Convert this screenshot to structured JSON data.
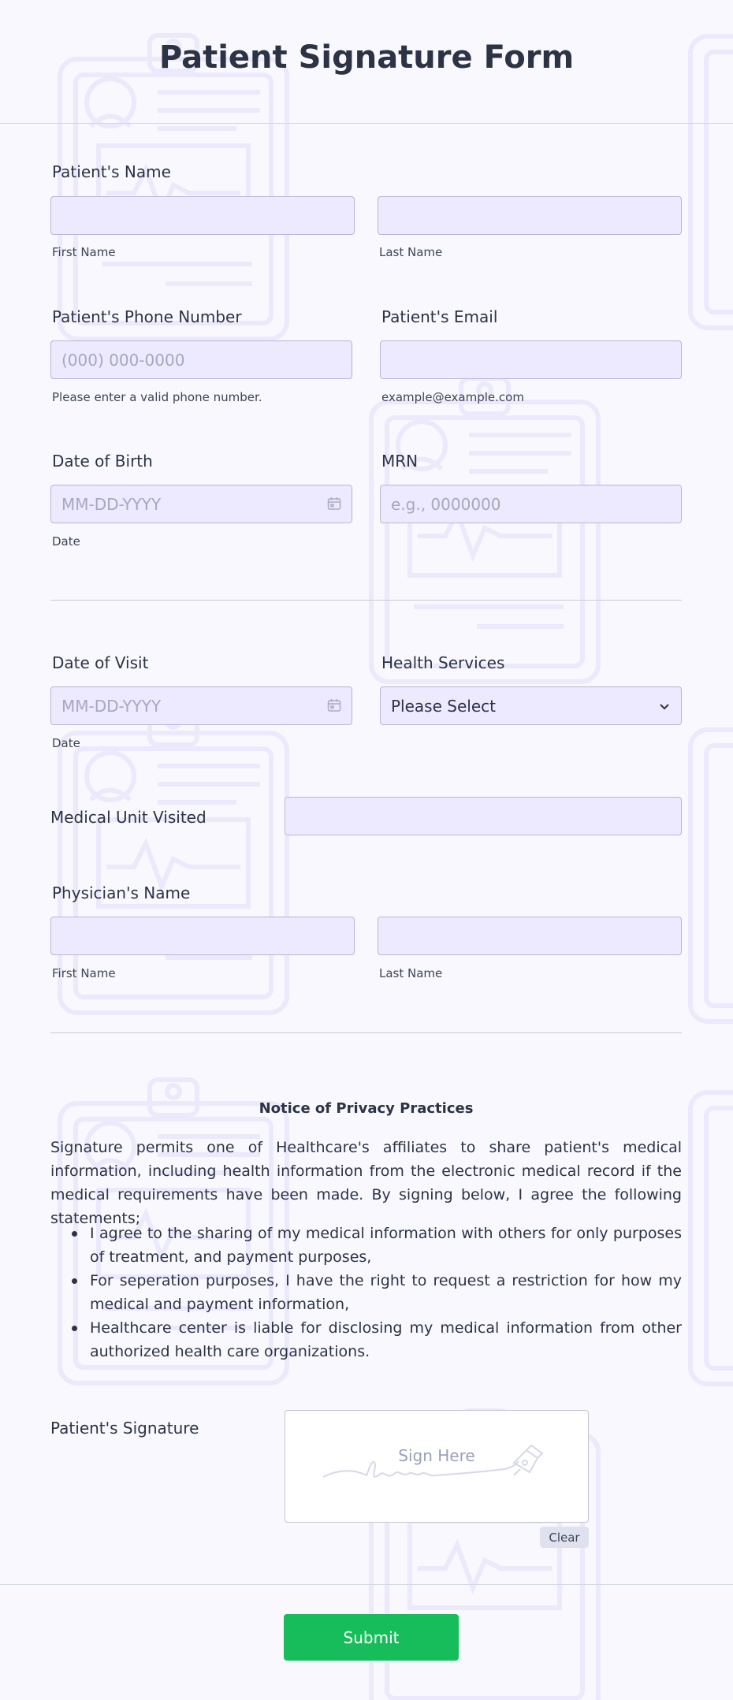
{
  "form": {
    "title": "Patient Signature Form"
  },
  "patient_name": {
    "label": "Patient's Name",
    "first_sublabel": "First Name",
    "last_sublabel": "Last Name",
    "first_value": "",
    "last_value": ""
  },
  "phone": {
    "label": "Patient's Phone Number",
    "placeholder": "(000) 000-0000",
    "sublabel": "Please enter a valid phone number."
  },
  "email": {
    "label": "Patient's Email",
    "placeholder": "",
    "sublabel": "example@example.com"
  },
  "dob": {
    "label": "Date of Birth",
    "placeholder": "MM-DD-YYYY",
    "sublabel": "Date"
  },
  "mrn": {
    "label": "MRN",
    "placeholder": "e.g., 0000000"
  },
  "visit_date": {
    "label": "Date of Visit",
    "placeholder": "MM-DD-YYYY",
    "sublabel": "Date"
  },
  "health_services": {
    "label": "Health Services",
    "selected": "Please Select"
  },
  "medical_unit": {
    "label": "Medical Unit Visited",
    "value": ""
  },
  "physician_name": {
    "label": "Physician's Name",
    "first_sublabel": "First Name",
    "last_sublabel": "Last Name"
  },
  "privacy": {
    "title": "Notice of Privacy Practices",
    "intro": "Signature permits one of Healthcare's affiliates to share patient's medical information, including health information from the electronic medical record if the medical requirements have been made. By signing below, I agree the following statements;",
    "items": [
      "I agree to the sharing of my medical information with others for only purposes of treatment, and payment purposes,",
      "For seperation purposes, I have the right to request a restriction for how my medical and payment information,",
      "Healthcare center is liable for disclosing my medical information from other authorized health care organizations."
    ]
  },
  "signature": {
    "label": "Patient's Signature",
    "placeholder": "Sign Here",
    "clear_label": "Clear"
  },
  "submit": {
    "label": "Submit"
  },
  "colors": {
    "background": "#f8f8fe",
    "input_fill": "#ede9fe",
    "submit": "#18bd5b",
    "text": "#2c3345"
  },
  "icons": {
    "date_picker": "calendar-icon",
    "select": "chevron-down-icon",
    "signature": "pen-nib-icon",
    "background": "clipboard-icon"
  }
}
